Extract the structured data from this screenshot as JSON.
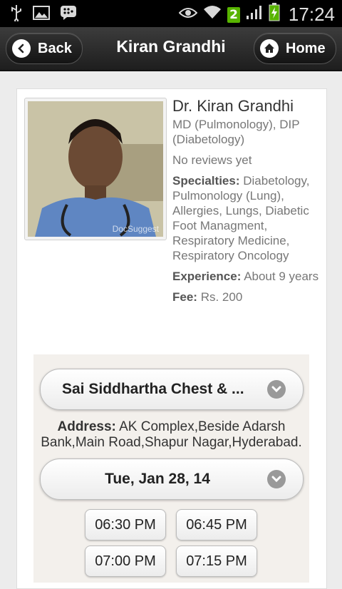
{
  "status_bar": {
    "time": "17:24",
    "sim_badge": "2",
    "icons": [
      "usb-icon",
      "image-icon",
      "bbm-icon",
      "eye-icon",
      "wifi-icon",
      "signal-icon",
      "battery-charging-icon"
    ]
  },
  "header": {
    "back_label": "Back",
    "title": "Kiran Grandhi",
    "home_label": "Home"
  },
  "doctor": {
    "name": "Dr. Kiran Grandhi",
    "degrees": "MD (Pulmonology), DIP (Diabetology)",
    "reviews": "No reviews yet",
    "specialties_label": "Specialties:",
    "specialties_value": "Diabetology, Pulmonology (Lung), Allergies, Lungs, Diabetic Foot Managment, Respiratory Medicine, Respiratory Oncology",
    "experience_label": "Experience:",
    "experience_value": "About 9 years",
    "fee_label": "Fee:",
    "fee_value": "Rs. 200",
    "photo_watermark": "DocSuggest"
  },
  "booking": {
    "clinic_selected": "Sai Siddhartha Chest & ...",
    "address_label": "Address:",
    "address_value": "AK Complex,Beside Adarsh Bank,Main Road,Shapur Nagar,Hyderabad.",
    "date_selected": "Tue, Jan 28, 14",
    "time_slots": [
      "06:30 PM",
      "06:45 PM",
      "07:00 PM",
      "07:15 PM"
    ]
  },
  "colors": {
    "header_bg": "#262626",
    "sim_badge": "#58b400",
    "panel_bg": "#f3f0ec"
  }
}
